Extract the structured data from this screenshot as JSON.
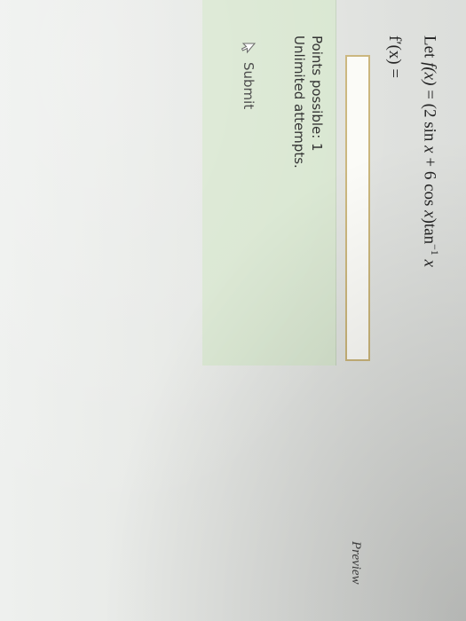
{
  "question": {
    "prefix": "Let ",
    "fx": "f(x)",
    "equals": " = (2 sin ",
    "x1": "x",
    "mid": " + 6 cos ",
    "x2": "x",
    "tan": ")tan",
    "sup": "−1",
    "x3": " x"
  },
  "answer": {
    "label": "f′(x) =",
    "value": "",
    "preview_label": "Preview"
  },
  "info": {
    "points": "Points possible: 1",
    "attempts": "Unlimited attempts."
  },
  "submit": {
    "label": "Submit"
  }
}
